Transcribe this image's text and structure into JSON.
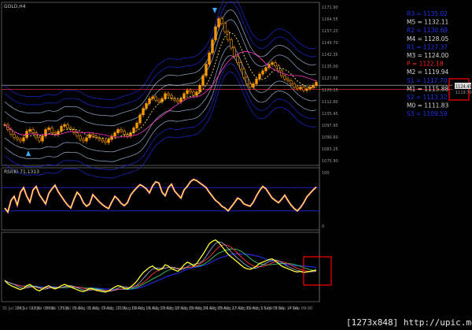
{
  "window": {
    "symbol_label": "GOLD,H4",
    "rsi_label": "RSI(8) 71.1313",
    "watermark": "[1273x848] http://upic.me/"
  },
  "colors": {
    "background": "#000000",
    "price_axis_bg": "#000000",
    "candle_up": "#ff9900",
    "candle_down": "#ff9900",
    "band_blue": "#1f2bd9",
    "band_light": "#9fb3d9",
    "ma_dash": "#ffe066",
    "ma_magenta": "#ff33cc",
    "rsi_line": "#ffff33",
    "red_box": "#ff0000",
    "arrow": "#3fa9f5",
    "level_white": "#d8d8d8",
    "level_blue": "#2233ee",
    "level_red": "#ff2222"
  },
  "levels": [
    {
      "label": "R3 = 1135.02",
      "color": "#2233ee"
    },
    {
      "label": "M5 = 1132.11",
      "color": "#d8d8d8"
    },
    {
      "label": "R2 = 1130.69",
      "color": "#2233ee"
    },
    {
      "label": "M4 = 1128.05",
      "color": "#d8d8d8"
    },
    {
      "label": "R1 = 1127.37",
      "color": "#2233ee"
    },
    {
      "label": "M3 = 1124.00",
      "color": "#d8d8d8"
    },
    {
      "label": "P  = 1122.18",
      "color": "#ff2222"
    },
    {
      "label": "M2 = 1119.94",
      "color": "#d8d8d8"
    },
    {
      "label": "S1 = 1117.70",
      "color": "#2233ee"
    },
    {
      "label": "M1 = 1115.88",
      "color": "#d8d8d8"
    },
    {
      "label": "S2 = 1113.32",
      "color": "#2233ee"
    },
    {
      "label": "M0 = 1111.83",
      "color": "#d8d8d8"
    },
    {
      "label": "S3 = 1109.59",
      "color": "#2233ee"
    }
  ],
  "chart_data": [
    {
      "type": "candlestick",
      "title": "GOLD,H4",
      "ylim": [
        1074,
        1172
      ],
      "y_ticks": [
        "1171.90",
        "1164.55",
        "1157.20",
        "1149.70",
        "1142.35",
        "1135.00",
        "1127.65",
        "1120.15",
        "1112.80",
        "1105.45",
        "1097.95",
        "1090.60",
        "1083.25",
        "1075.90"
      ],
      "current_price_label": "1124.45",
      "current_price_label_2": "1119.70",
      "horizontal_lines": [
        1122.18,
        1119.7
      ],
      "x_ticks": [
        "31 Jul 2015",
        "24 Jul 01:00",
        "28 Jul 09:00",
        "29 Jul 17:00",
        "31 Jul 09:00",
        "5 Aug 01:00",
        "6 Aug 09:00",
        "7 Aug 17:00",
        "11 Aug 09:00",
        "13 Aug 01:00",
        "14 Aug 09:00",
        "17 Aug 17:00",
        "19 Aug 09:00",
        "21 Aug 01:00",
        "24 Aug 09:00",
        "25 Aug 17:00",
        "27 Aug 09:00",
        "31 Aug 17:00",
        "1 Sep 09:00",
        "3 Sep 17:00",
        "4 Sep 09:00"
      ],
      "close": [
        1098,
        1095,
        1092,
        1090,
        1089,
        1088,
        1090,
        1094,
        1095,
        1093,
        1090,
        1088,
        1091,
        1095,
        1096,
        1093,
        1092,
        1094,
        1097,
        1098,
        1096,
        1095,
        1093,
        1091,
        1089,
        1088,
        1090,
        1092,
        1091,
        1090,
        1089,
        1088,
        1087,
        1089,
        1091,
        1093,
        1095,
        1094,
        1092,
        1091,
        1093,
        1096,
        1099,
        1104,
        1108,
        1111,
        1114,
        1115,
        1113,
        1112,
        1114,
        1117,
        1116,
        1114,
        1113,
        1112,
        1114,
        1117,
        1119,
        1118,
        1116,
        1118,
        1122,
        1128,
        1135,
        1142,
        1150,
        1158,
        1163,
        1160,
        1155,
        1150,
        1145,
        1140,
        1136,
        1132,
        1127,
        1123,
        1121,
        1123,
        1126,
        1129,
        1131,
        1133,
        1135,
        1136,
        1134,
        1131,
        1128,
        1126,
        1125,
        1123,
        1121,
        1120,
        1121,
        1119,
        1120,
        1121,
        1122,
        1124
      ]
    },
    {
      "type": "line",
      "title": "RSI(8) 71.1313",
      "ylim": [
        0,
        100
      ],
      "y_ticks": [
        "100",
        "0"
      ],
      "series": [
        {
          "values": [
            35,
            28,
            48,
            55,
            40,
            62,
            70,
            55,
            45,
            66,
            72,
            58,
            50,
            42,
            60,
            68,
            74,
            63,
            55,
            47,
            40,
            35,
            50,
            62,
            56,
            44,
            38,
            42,
            58,
            52,
            46,
            41,
            37,
            34,
            45,
            55,
            50,
            43,
            39,
            44,
            57,
            64,
            70,
            75,
            72,
            68,
            61,
            73,
            80,
            78,
            62,
            56,
            70,
            76,
            64,
            58,
            52,
            66,
            72,
            80,
            84,
            82,
            78,
            74,
            70,
            62,
            55,
            48,
            44,
            38,
            35,
            30,
            37,
            44,
            52,
            49,
            42,
            40,
            38,
            45,
            56,
            65,
            72,
            68,
            60,
            52,
            48,
            44,
            50,
            57,
            48,
            40,
            34,
            30,
            36,
            44,
            54,
            60,
            66,
            71
          ]
        }
      ]
    },
    {
      "type": "line",
      "title": "",
      "ylim": [
        0,
        100
      ],
      "series": [
        {
          "values": [
            30,
            25,
            22,
            20,
            18,
            16,
            18,
            22,
            24,
            20,
            16,
            14,
            17,
            20,
            22,
            19,
            17,
            19,
            22,
            24,
            22,
            20,
            18,
            16,
            14,
            13,
            15,
            18,
            17,
            15,
            14,
            13,
            12,
            14,
            17,
            20,
            22,
            21,
            18,
            17,
            20,
            24,
            29,
            36,
            42,
            46,
            50,
            52,
            48,
            46,
            48,
            54,
            52,
            48,
            46,
            44,
            48,
            54,
            58,
            56,
            52,
            56,
            63,
            70,
            78,
            86,
            90,
            92,
            88,
            82,
            76,
            70,
            66,
            62,
            58,
            54,
            50,
            48,
            47,
            49,
            52,
            56,
            58,
            60,
            62,
            63,
            60,
            56,
            52,
            50,
            48,
            46,
            44,
            43,
            44,
            42,
            43,
            44,
            45,
            46
          ]
        }
      ]
    }
  ]
}
